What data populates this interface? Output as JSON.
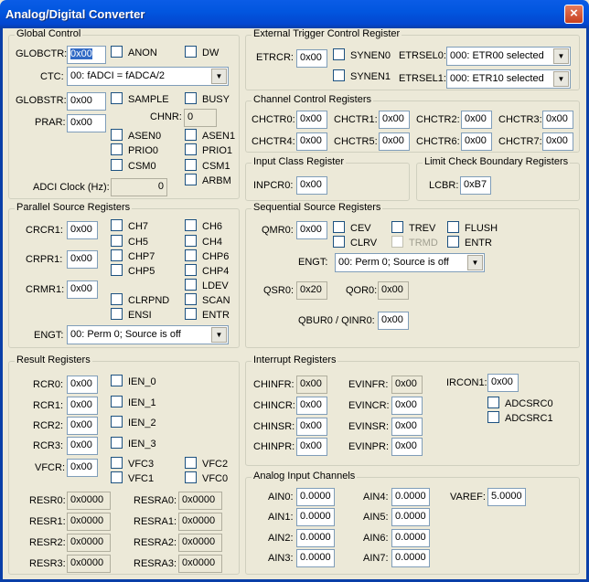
{
  "window": {
    "title": "Analog/Digital Converter",
    "close": "×"
  },
  "global": {
    "title": "Global Control",
    "globctr_label": "GLOBCTR:",
    "globctr": "0x00",
    "anon": "ANON",
    "dw": "DW",
    "ctc_label": "CTC:",
    "ctc": "00: fADCI = fADCA/2",
    "globstr_label": "GLOBSTR:",
    "globstr": "0x00",
    "sample": "SAMPLE",
    "busy": "BUSY",
    "chnr_label": "CHNR:",
    "chnr": "0",
    "prar_label": "PRAR:",
    "prar": "0x00",
    "asen0": "ASEN0",
    "asen1": "ASEN1",
    "prio0": "PRIO0",
    "prio1": "PRIO1",
    "csm0": "CSM0",
    "csm1": "CSM1",
    "arbm": "ARBM",
    "clock_label": "ADCI Clock (Hz):",
    "clock": "0"
  },
  "ext": {
    "title": "External Trigger Control Register",
    "etrcr_label": "ETRCR:",
    "etrcr": "0x00",
    "synen0": "SYNEN0",
    "synen1": "SYNEN1",
    "etrsel0_label": "ETRSEL0:",
    "etrsel0": "000: ETR00 selected",
    "etrsel1_label": "ETRSEL1:",
    "etrsel1": "000: ETR10 selected"
  },
  "chctr": {
    "title": "Channel Control Registers",
    "items": [
      {
        "label": "CHCTR0:",
        "value": "0x00"
      },
      {
        "label": "CHCTR1:",
        "value": "0x00"
      },
      {
        "label": "CHCTR2:",
        "value": "0x00"
      },
      {
        "label": "CHCTR3:",
        "value": "0x00"
      },
      {
        "label": "CHCTR4:",
        "value": "0x00"
      },
      {
        "label": "CHCTR5:",
        "value": "0x00"
      },
      {
        "label": "CHCTR6:",
        "value": "0x00"
      },
      {
        "label": "CHCTR7:",
        "value": "0x00"
      }
    ]
  },
  "inpcr": {
    "title": "Input Class Register",
    "label": "INPCR0:",
    "value": "0x00"
  },
  "lcbr": {
    "title": "Limit Check Boundary Registers",
    "label": "LCBR:",
    "value": "0xB7"
  },
  "parallel": {
    "title": "Parallel Source Registers",
    "crcr1_label": "CRCR1:",
    "crcr1": "0x00",
    "crpr1_label": "CRPR1:",
    "crpr1": "0x00",
    "crmr1_label": "CRMR1:",
    "crmr1": "0x00",
    "ch7": "CH7",
    "ch6": "CH6",
    "ch5": "CH5",
    "ch4": "CH4",
    "chp7": "CHP7",
    "chp6": "CHP6",
    "chp5": "CHP5",
    "chp4": "CHP4",
    "ldev": "LDEV",
    "clrpnd": "CLRPND",
    "scan": "SCAN",
    "ensi": "ENSI",
    "entr": "ENTR",
    "engt_label": "ENGT:",
    "engt": "00: Perm 0; Source is off"
  },
  "seq": {
    "title": "Sequential Source Registers",
    "qmr0_label": "QMR0:",
    "qmr0": "0x00",
    "cev": "CEV",
    "trev": "TREV",
    "flush": "FLUSH",
    "clrv": "CLRV",
    "trmd": "TRMD",
    "entr": "ENTR",
    "engt_label": "ENGT:",
    "engt": "00: Perm 0; Source is off",
    "qsr0_label": "QSR0:",
    "qsr0": "0x20",
    "qor0_label": "QOR0:",
    "qor0": "0x00",
    "qbur0_label": "QBUR0 / QINR0:",
    "qbur0": "0x00"
  },
  "result": {
    "title": "Result Registers",
    "rcr0_label": "RCR0:",
    "rcr0": "0x00",
    "rcr1_label": "RCR1:",
    "rcr1": "0x00",
    "rcr2_label": "RCR2:",
    "rcr2": "0x00",
    "rcr3_label": "RCR3:",
    "rcr3": "0x00",
    "ien0": "IEN_0",
    "ien1": "IEN_1",
    "ien2": "IEN_2",
    "ien3": "IEN_3",
    "vfcr_label": "VFCR:",
    "vfcr": "0x00",
    "vfc3": "VFC3",
    "vfc2": "VFC2",
    "vfc1": "VFC1",
    "vfc0": "VFC0",
    "resr": [
      {
        "label": "RESR0:",
        "value": "0x0000"
      },
      {
        "label": "RESR1:",
        "value": "0x0000"
      },
      {
        "label": "RESR2:",
        "value": "0x0000"
      },
      {
        "label": "RESR3:",
        "value": "0x0000"
      }
    ],
    "resra": [
      {
        "label": "RESRA0:",
        "value": "0x0000"
      },
      {
        "label": "RESRA1:",
        "value": "0x0000"
      },
      {
        "label": "RESRA2:",
        "value": "0x0000"
      },
      {
        "label": "RESRA3:",
        "value": "0x0000"
      }
    ]
  },
  "irq": {
    "title": "Interrupt Registers",
    "chinfr_label": "CHINFR:",
    "chinfr": "0x00",
    "chincr_label": "CHINCR:",
    "chincr": "0x00",
    "chinsr_label": "CHINSR:",
    "chinsr": "0x00",
    "chinpr_label": "CHINPR:",
    "chinpr": "0x00",
    "evinfr_label": "EVINFR:",
    "evinfr": "0x00",
    "evincr_label": "EVINCR:",
    "evincr": "0x00",
    "evinsr_label": "EVINSR:",
    "evinsr": "0x00",
    "evinpr_label": "EVINPR:",
    "evinpr": "0x00",
    "ircon1_label": "IRCON1:",
    "ircon1": "0x00",
    "adcsrc0": "ADCSRC0",
    "adcsrc1": "ADCSRC1"
  },
  "ain": {
    "title": "Analog Input Channels",
    "items": [
      {
        "label": "AIN0:",
        "value": "0.0000"
      },
      {
        "label": "AIN1:",
        "value": "0.0000"
      },
      {
        "label": "AIN2:",
        "value": "0.0000"
      },
      {
        "label": "AIN3:",
        "value": "0.0000"
      },
      {
        "label": "AIN4:",
        "value": "0.0000"
      },
      {
        "label": "AIN5:",
        "value": "0.0000"
      },
      {
        "label": "AIN6:",
        "value": "0.0000"
      },
      {
        "label": "AIN7:",
        "value": "0.0000"
      }
    ],
    "varef_label": "VAREF:",
    "varef": "5.0000"
  }
}
